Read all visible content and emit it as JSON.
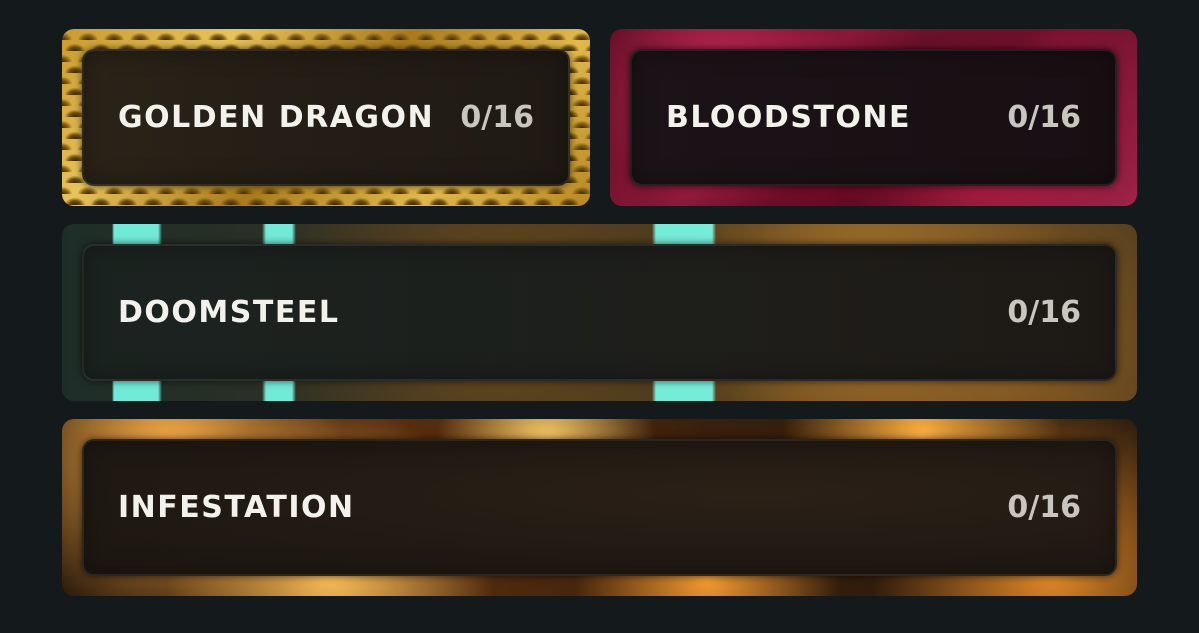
{
  "collections": [
    {
      "name": "GOLDEN DRAGON",
      "count": "0/16"
    },
    {
      "name": "BLOODSTONE",
      "count": "0/16"
    },
    {
      "name": "DOOMSTEEL",
      "count": "0/16"
    },
    {
      "name": "INFESTATION",
      "count": "0/16"
    }
  ],
  "colors": {
    "background": "#14191c",
    "text": "#f3f1ec",
    "count_text": "#c9c6bf"
  }
}
